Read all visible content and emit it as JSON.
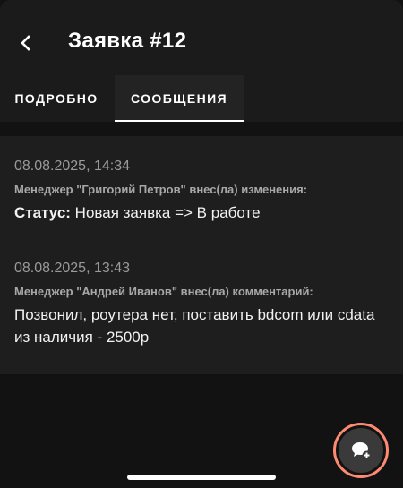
{
  "header": {
    "back_icon": "chevron-left-icon",
    "title": "Заявка #12"
  },
  "tabs": [
    {
      "label": "ПОДРОБНО",
      "active": false
    },
    {
      "label": "СООБЩЕНИЯ",
      "active": true
    }
  ],
  "messages": [
    {
      "time": "08.08.2025, 14:34",
      "author": "Менеджер \"Григорий Петров\" внес(ла) изменения:",
      "label": "Статус:",
      "text": " Новая заявка => В работе"
    },
    {
      "time": "08.08.2025, 13:43",
      "author": "Менеджер \"Андрей Иванов\" внес(ла) комментарий:",
      "text": "Позвонил, роутера нет, поставить bdcom или cdata из наличия - 2500р"
    }
  ],
  "fab": {
    "icon": "add-comment-icon",
    "highlight_color": "#ff8a72"
  }
}
